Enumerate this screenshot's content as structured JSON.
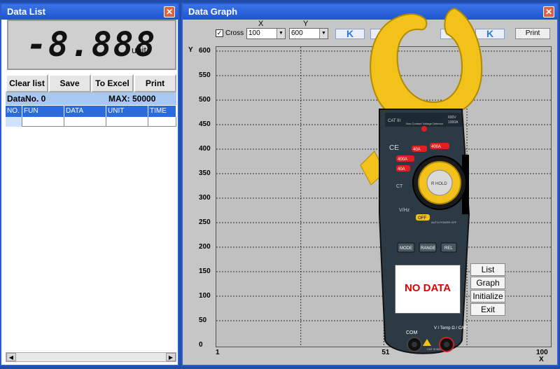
{
  "left_window": {
    "title": "Data List",
    "close": "✕",
    "display": {
      "value": "-8.888",
      "unit": "unit"
    },
    "buttons": [
      "Clear list",
      "Save",
      "To Excel",
      "Print"
    ],
    "data_no_label": "DataNo.  0",
    "max_label": "MAX:  50000",
    "columns": [
      "NO.",
      "FUN",
      "DATA",
      "UNIT",
      "TIME"
    ]
  },
  "right_window": {
    "title": "Data Graph",
    "close": "✕",
    "cross_label": "Cross",
    "cross_checked": true,
    "x_label": "X",
    "y_label": "Y",
    "x_select": "100",
    "y_select": "600",
    "print": "Print",
    "nav": [
      "K",
      "<",
      ">",
      "K"
    ]
  },
  "chart_data": {
    "type": "line",
    "ylabel": "Y",
    "xlabel": "X",
    "ylim": [
      0,
      600
    ],
    "xlim": [
      1,
      100
    ],
    "yticks": [
      600,
      550,
      500,
      450,
      400,
      350,
      300,
      250,
      200,
      150,
      100,
      50,
      0
    ],
    "xticks": [
      1,
      51,
      100
    ],
    "grid": true,
    "series": []
  },
  "meter": {
    "cat": "CAT III",
    "ratings": [
      "600V",
      "1000A"
    ],
    "ncv": "Non-Contact Voltage Detector",
    "ranges": [
      "40A",
      "400A",
      "400A",
      "40A"
    ],
    "ct": "CT",
    "hold": "R HOLD",
    "vhz": "V/Hz",
    "off": "OFF",
    "auto_off": "AUTO POWER OFF",
    "keys": [
      "MODE",
      "RANGE",
      "REL"
    ],
    "com": "COM",
    "vtemp": "V / Temp Ω / CAP",
    "jack_rating": "CAT III 600V",
    "screen_text": "NO DATA",
    "side_buttons": [
      "List",
      "Graph",
      "Initialize",
      "Exit"
    ],
    "colors": {
      "body": "#2c3a45",
      "clamp": "#f2c21a",
      "red": "#e02020"
    }
  }
}
